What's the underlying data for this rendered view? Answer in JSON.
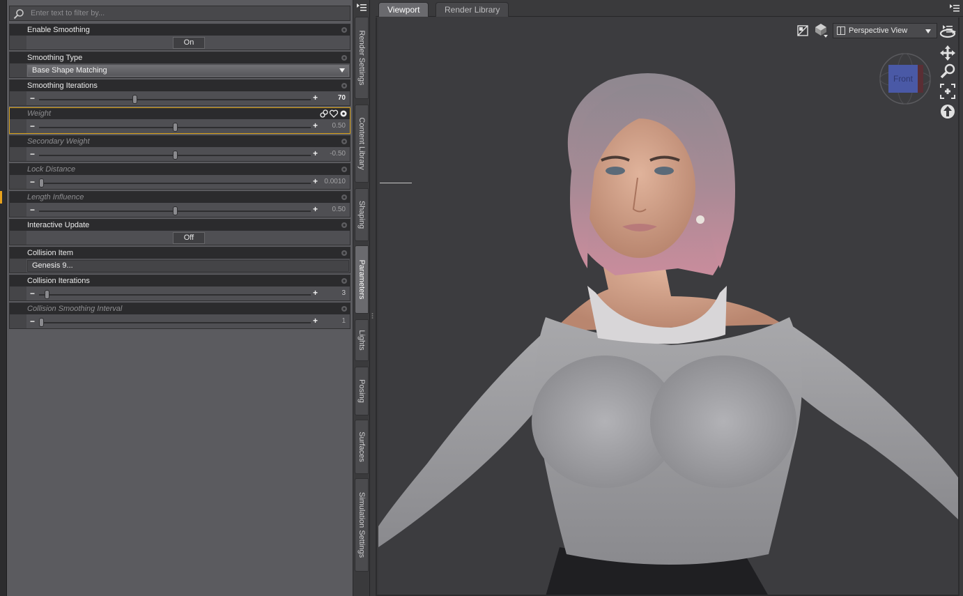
{
  "filter": {
    "placeholder": "Enter text to filter by..."
  },
  "properties": {
    "enable_smoothing": {
      "label": "Enable Smoothing",
      "value": "On"
    },
    "smoothing_type": {
      "label": "Smoothing Type",
      "value": "Base Shape Matching"
    },
    "smoothing_iterations": {
      "label": "Smoothing Iterations",
      "value": "70",
      "fraction": 0.35
    },
    "weight": {
      "label": "Weight",
      "value": "0.50",
      "fraction": 0.5
    },
    "secondary_weight": {
      "label": "Secondary Weight",
      "value": "-0.50",
      "fraction": 0.5
    },
    "lock_distance": {
      "label": "Lock Distance",
      "value": "0.0010",
      "fraction": 0.0
    },
    "length_influence": {
      "label": "Length Influence",
      "value": "0.50",
      "fraction": 0.5
    },
    "interactive_update": {
      "label": "Interactive Update",
      "value": "Off"
    },
    "collision_item": {
      "label": "Collision Item",
      "value": "Genesis 9..."
    },
    "collision_iterations": {
      "label": "Collision Iterations",
      "value": "3",
      "fraction": 0.02
    },
    "collision_smoothing_interval": {
      "label": "Collision Smoothing Interval",
      "value": "1",
      "fraction": 0.0
    }
  },
  "side_tabs": {
    "render_settings": "Render Settings",
    "content_library": "Content Library",
    "shaping": "Shaping",
    "parameters": "Parameters",
    "lights": "Lights",
    "posing": "Posing",
    "surfaces": "Surfaces",
    "simulation_settings": "Simulation Settings"
  },
  "viewport_tabs": {
    "viewport": "Viewport",
    "render_library": "Render Library"
  },
  "viewport": {
    "view_name": "Perspective View",
    "cube_label": "Front"
  },
  "colors": {
    "accent": "#d9a218",
    "panel": "#5b5b5f",
    "header": "#2b2b2d",
    "background": "#3b3b3d"
  },
  "icons": [
    "search-icon",
    "gear-icon",
    "menu-icon",
    "link-icon",
    "heart-icon",
    "orbit-icon",
    "pan-icon",
    "zoom-icon",
    "frame-icon",
    "up-icon"
  ]
}
